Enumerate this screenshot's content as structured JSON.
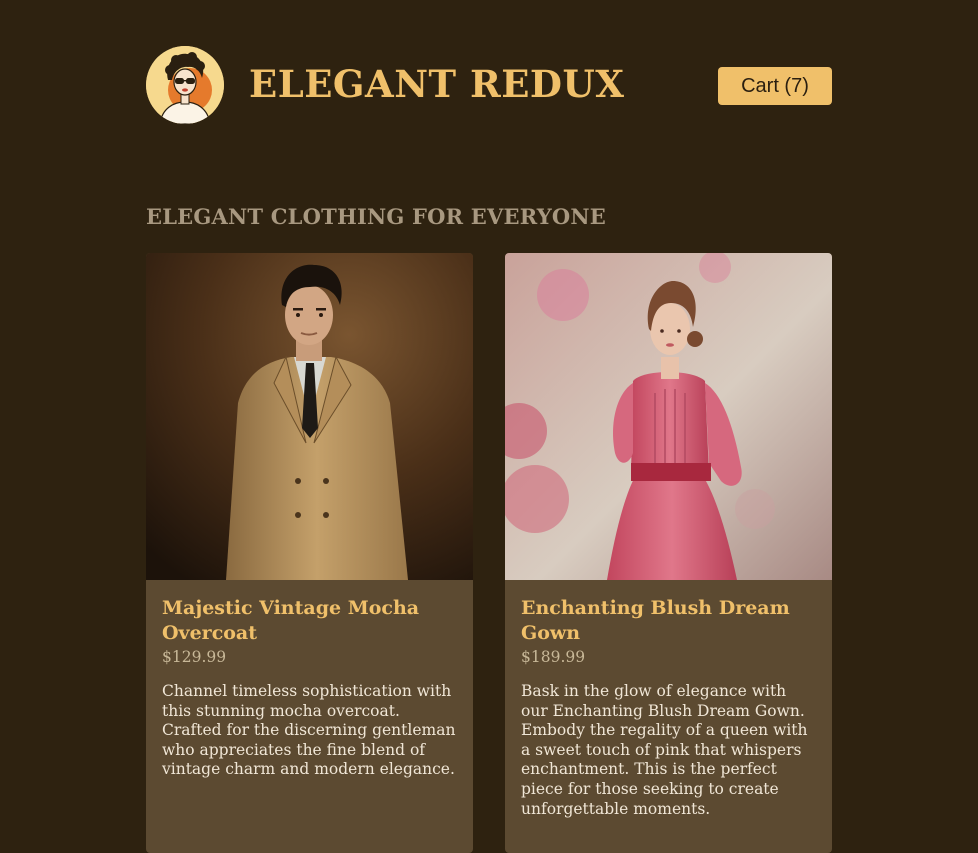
{
  "header": {
    "brand": "ELEGANT REDUX",
    "cart_label": "Cart (7)"
  },
  "section": {
    "title": "ELEGANT CLOTHING FOR EVERYONE"
  },
  "products": [
    {
      "title": "Majestic Vintage Mocha Overcoat",
      "price": "$129.99",
      "description": "Channel timeless sophistication with this stunning mocha overcoat. Crafted for the discerning gentleman who appreciates the fine blend of vintage charm and modern elegance."
    },
    {
      "title": "Enchanting Blush Dream Gown",
      "price": "$189.99",
      "description": "Bask in the glow of elegance with our Enchanting Blush Dream Gown. Embody the regality of a queen with a sweet touch of pink that whispers enchantment. This is the perfect piece for those seeking to create unforgettable moments."
    }
  ],
  "colors": {
    "background": "#2e2210",
    "accent": "#f0c06a",
    "card": "#5c4a31",
    "muted_heading": "#a89880"
  },
  "icons": {
    "logo": "retro-woman-avatar-logo"
  }
}
